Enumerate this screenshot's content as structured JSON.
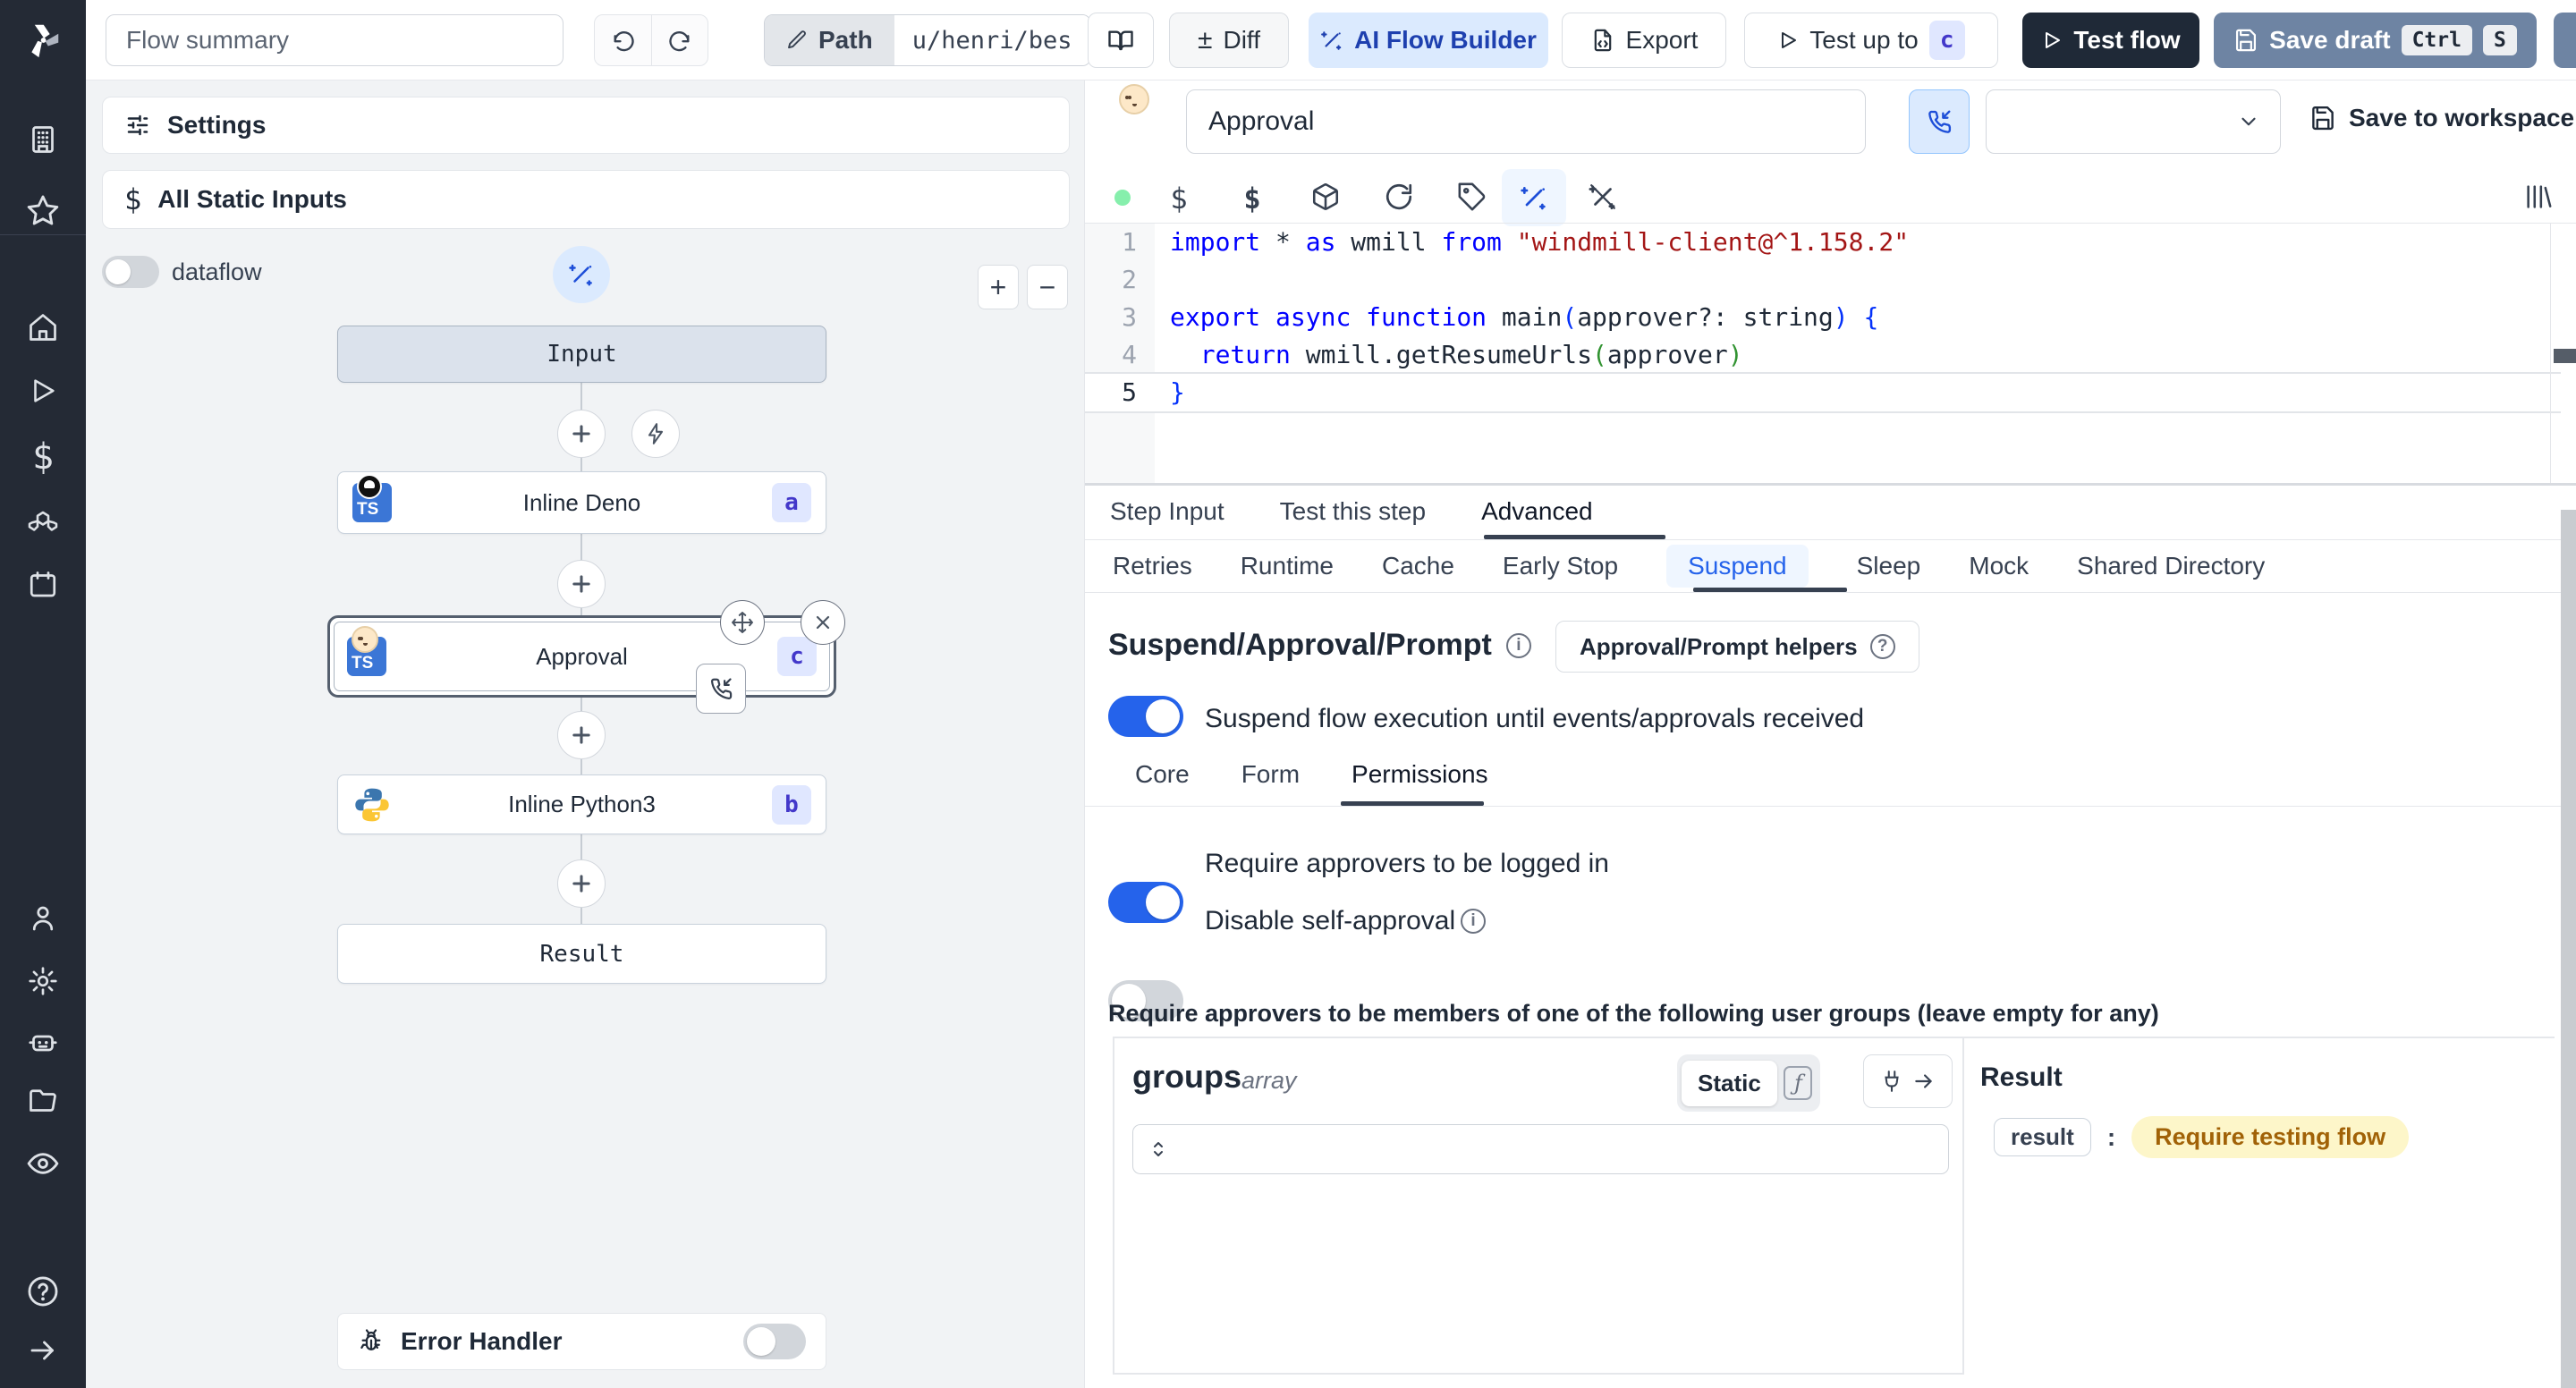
{
  "colors": {
    "accent_blue": "#2563eb",
    "toggle_on": "#2563eb",
    "ai_button_bg": "#dbeafe",
    "ai_button_text": "#1e40af",
    "test_flow_bg": "#1f2937",
    "save_draft_bg": "#6e84a3",
    "node_badge_bg": "#e0e7ff",
    "node_badge_text": "#4338ca",
    "result_badge_bg": "#fdf6c9",
    "result_badge_text": "#a16207",
    "code_keyword": "#0000ff",
    "code_string": "#a31515"
  },
  "topbar": {
    "flow_summary_value": "Flow summary",
    "path_label": "Path",
    "path_value": "u/henri/bes",
    "diff_sign": "±",
    "diff_label": "Diff",
    "ai_flow_builder_label": "AI Flow Builder",
    "export_label": "Export",
    "test_up_to_label": "Test up to",
    "test_up_to_badge": "c",
    "test_flow_label": "Test flow",
    "save_draft_label": "Save draft",
    "save_draft_kbd1": "Ctrl",
    "save_draft_kbd2": "S"
  },
  "sidebar": {
    "icons": [
      "workspace",
      "favorites",
      "home",
      "runs",
      "variables",
      "resources",
      "schedules",
      "users",
      "settings",
      "workers",
      "folders",
      "audit-logs",
      "help",
      "expand"
    ]
  },
  "flow_panel": {
    "settings_label": "Settings",
    "static_inputs_label": "All Static Inputs",
    "dataflow_label": "dataflow",
    "error_handler_label": "Error Handler",
    "nodes": {
      "input_label": "Input",
      "deno": {
        "label": "Inline Deno",
        "badge": "a",
        "lang": "TS"
      },
      "approval": {
        "label": "Approval",
        "badge": "c",
        "lang": "TS"
      },
      "python": {
        "label": "Inline Python3",
        "badge": "b"
      },
      "result_label": "Result"
    }
  },
  "editor": {
    "name_value": "Approval",
    "lang_badge": "TS",
    "save_to_workspace_label": "Save to workspace"
  },
  "code": {
    "lines": [
      {
        "num": "1",
        "active": false,
        "tokens": [
          [
            "import",
            "kw"
          ],
          [
            " * ",
            "pl"
          ],
          [
            "as",
            "kw"
          ],
          [
            " wmill ",
            "pl"
          ],
          [
            "from",
            "kw"
          ],
          [
            " ",
            "pl"
          ],
          [
            "\"windmill-client@^1.158.2\"",
            "str"
          ]
        ]
      },
      {
        "num": "2",
        "active": false,
        "tokens": []
      },
      {
        "num": "3",
        "active": false,
        "tokens": [
          [
            "export",
            "kw"
          ],
          [
            " ",
            "pl"
          ],
          [
            "async",
            "kw"
          ],
          [
            " ",
            "pl"
          ],
          [
            "function",
            "kw"
          ],
          [
            " main",
            "pl"
          ],
          [
            "(",
            "pa"
          ],
          [
            "approver?: string",
            "pl"
          ],
          [
            ")",
            "pa"
          ],
          [
            " {",
            "pa"
          ]
        ]
      },
      {
        "num": "4",
        "active": false,
        "tokens": [
          [
            "  ",
            "pl"
          ],
          [
            "return",
            "kw"
          ],
          [
            " wmill.getResumeUrls",
            "pl"
          ],
          [
            "(",
            "pg"
          ],
          [
            "approver",
            "pl"
          ],
          [
            ")",
            "pg"
          ]
        ]
      },
      {
        "num": "5",
        "active": true,
        "tokens": [
          [
            "}",
            "pa"
          ]
        ]
      }
    ]
  },
  "step_tabs": {
    "items": [
      "Step Input",
      "Test this step",
      "Advanced"
    ],
    "active": "Advanced"
  },
  "advanced_tabs": {
    "items": [
      "Retries",
      "Runtime",
      "Cache",
      "Early Stop",
      "Suspend",
      "Sleep",
      "Mock",
      "Shared Directory"
    ],
    "active": "Suspend"
  },
  "suspend": {
    "title": "Suspend/Approval/Prompt",
    "helpers_button_label": "Approval/Prompt helpers",
    "suspend_toggle_label": "Suspend flow execution until events/approvals received",
    "subtabs": {
      "items": [
        "Core",
        "Form",
        "Permissions"
      ],
      "active": "Permissions"
    },
    "require_login_label": "Require approvers to be logged in",
    "disable_self_approval_label": "Disable self-approval",
    "groups_heading": "Require approvers to be members of one of the following user groups (leave empty for any)"
  },
  "groups_field": {
    "name": "groups",
    "type_label": "array",
    "static_label": "Static",
    "fx_glyph": "ƒ"
  },
  "result_panel": {
    "title": "Result",
    "key": "result",
    "separator": ":",
    "value": "Require testing flow"
  }
}
